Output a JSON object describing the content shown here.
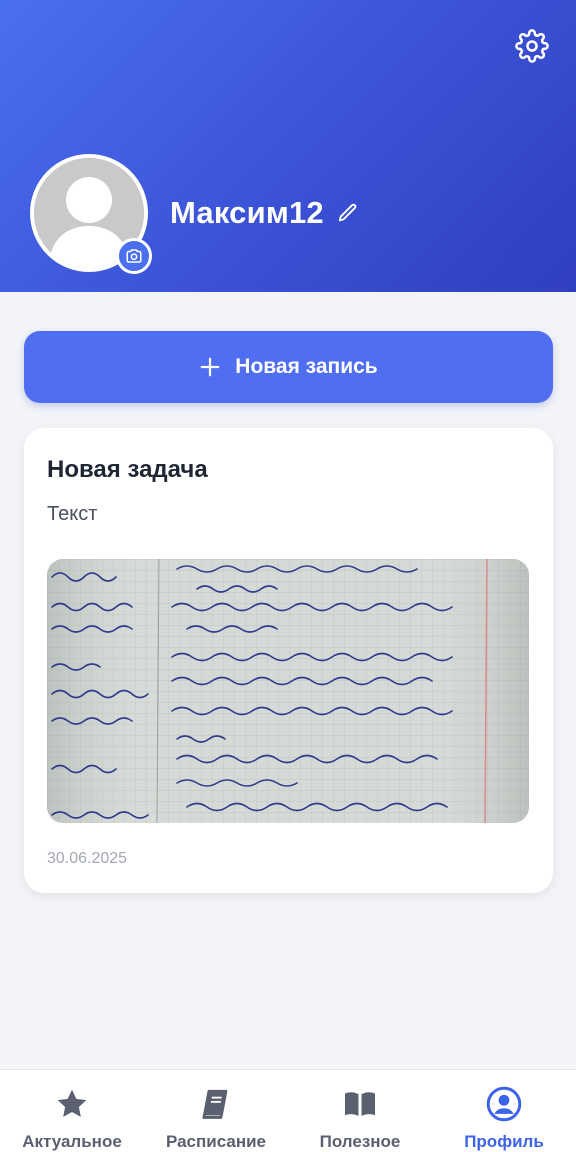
{
  "header": {
    "username": "Максим12",
    "settings_icon": "gear-icon",
    "camera_icon": "camera-icon",
    "edit_icon": "pencil-icon"
  },
  "actions": {
    "new_entry_label": "Новая запись",
    "new_entry_icon": "plus-icon"
  },
  "card": {
    "title": "Новая задача",
    "text": "Текст",
    "date": "30.06.2025",
    "image_description_icon": "notebook-photo"
  },
  "nav": {
    "items": [
      {
        "label": "Актуальное",
        "icon": "star-icon"
      },
      {
        "label": "Расписание",
        "icon": "book-icon"
      },
      {
        "label": "Полезное",
        "icon": "open-book-icon"
      },
      {
        "label": "Профиль",
        "icon": "user-icon"
      }
    ],
    "active_index": 3
  },
  "colors": {
    "brand": "#4f6ef2",
    "active_nav": "#3d63e8"
  }
}
